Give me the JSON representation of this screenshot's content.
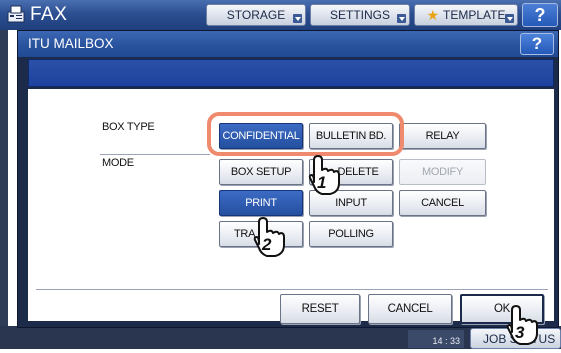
{
  "app": {
    "title": "FAX",
    "tabs": [
      {
        "label": "STORAGE"
      },
      {
        "label": "SETTINGS"
      },
      {
        "label": "TEMPLATE"
      }
    ],
    "help_label": "?",
    "clock": "14 : 33",
    "job_status_label": "JOB STATUS"
  },
  "dialog": {
    "title": "ITU MAILBOX",
    "help_label": "?",
    "box_type": {
      "label": "BOX TYPE",
      "options": [
        {
          "label": "CONFIDENTIAL",
          "selected": true
        },
        {
          "label": "BULLETIN BD.",
          "selected": false
        },
        {
          "label": "RELAY",
          "selected": false
        }
      ]
    },
    "mode": {
      "label": "MODE",
      "buttons": [
        {
          "label": "BOX SETUP",
          "selected": false,
          "enabled": true
        },
        {
          "label": "DELETE",
          "selected": false,
          "enabled": true
        },
        {
          "label": "MODIFY",
          "selected": false,
          "enabled": false
        },
        {
          "label": "PRINT",
          "selected": true,
          "enabled": true
        },
        {
          "label": "INPUT",
          "selected": false,
          "enabled": true
        },
        {
          "label": "CANCEL",
          "selected": false,
          "enabled": true
        },
        {
          "label": "TRA",
          "selected": false,
          "enabled": true
        },
        {
          "label": "POLLING",
          "selected": false,
          "enabled": true
        }
      ]
    },
    "footer": {
      "reset_label": "RESET",
      "cancel_label": "CANCEL",
      "ok_label": "OK"
    }
  },
  "annotations": {
    "step_markers": [
      {
        "label": "1"
      },
      {
        "label": "2"
      },
      {
        "label": "3"
      }
    ],
    "highlight_color": "#f08a6e"
  },
  "colors": {
    "title_bar": "#2a539e",
    "selected_button": "#24509f",
    "dialog_frame": "#1c2b4a"
  }
}
